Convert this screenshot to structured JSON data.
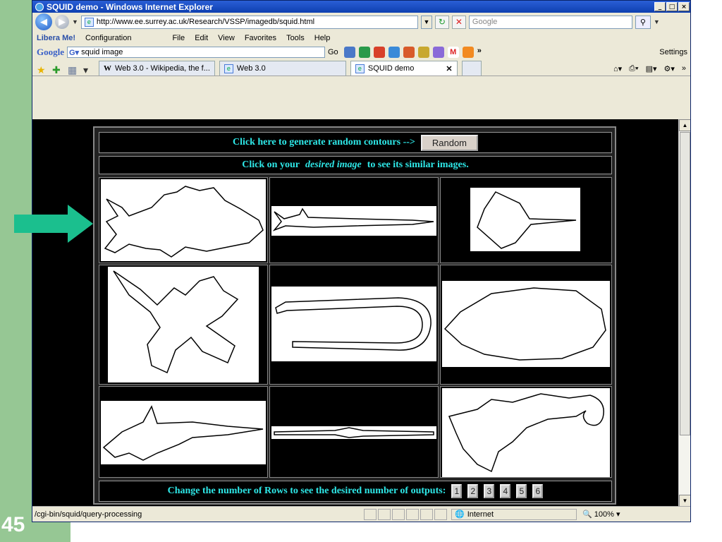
{
  "slide": {
    "number": "45"
  },
  "window": {
    "title": "SQUID demo - Windows Internet Explorer",
    "controls": [
      "_",
      "□",
      "×"
    ]
  },
  "address": {
    "url": "http://www.ee.surrey.ac.uk/Research/VSSP/imagedb/squid.html",
    "search_placeholder": "Google"
  },
  "menubar": {
    "libera": "Libera Me!",
    "configuration": "Configuration",
    "items": [
      "File",
      "Edit",
      "View",
      "Favorites",
      "Tools",
      "Help"
    ]
  },
  "googlebar": {
    "logo": "Google",
    "query": "squid image",
    "go": "Go",
    "settings": "Settings"
  },
  "tabs": [
    {
      "label": "Web 3.0 - Wikipedia, the f..."
    },
    {
      "label": "Web 3.0"
    },
    {
      "label": "SQUID demo"
    }
  ],
  "page": {
    "random_prompt": "Click here to generate random contours -->",
    "random_button": "Random",
    "instruction_pre": "Click on your",
    "instruction_em": "desired image",
    "instruction_post": "to see its similar images.",
    "rows_prompt": "Change the number of Rows to see the desired number of outputs:",
    "row_buttons": [
      "1",
      "2",
      "3",
      "4",
      "5",
      "6"
    ]
  },
  "statusbar": {
    "message": "/cgi-bin/squid/query-processing",
    "zone": "Internet",
    "zoom": "100%"
  },
  "colors": {
    "page_text": "#2ee8e8",
    "arrow": "#1bbf8e",
    "slide_green": "#96c794"
  }
}
